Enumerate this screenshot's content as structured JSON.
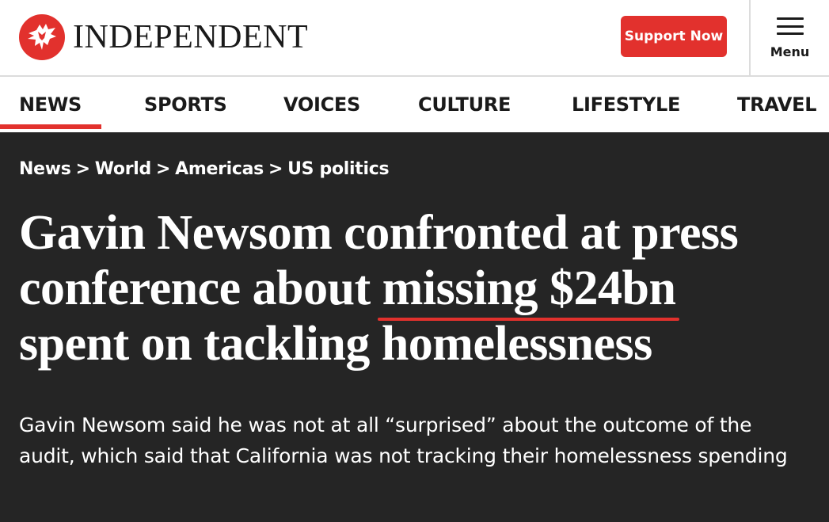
{
  "brand": {
    "name": "INDEPENDENT",
    "logo_icon": "eagle-icon",
    "accent_color": "#e2312d"
  },
  "header": {
    "support_label": "Support Now",
    "menu_label": "Menu",
    "menu_icon": "hamburger-icon"
  },
  "nav": {
    "items": [
      {
        "label": "NEWS",
        "active": true
      },
      {
        "label": "SPORTS"
      },
      {
        "label": "VOICES"
      },
      {
        "label": "CULTURE"
      },
      {
        "label": "LIFESTYLE"
      },
      {
        "label": "TRAVEL"
      }
    ]
  },
  "article": {
    "breadcrumb": [
      "News",
      "World",
      "Americas",
      "US politics"
    ],
    "breadcrumb_separator": ">",
    "headline": {
      "line1": "Gavin Newsom confronted at press",
      "line2_before": "conference about ",
      "line2_highlight": "missing $24bn",
      "line3": "spent on tackling homelessness"
    },
    "standfirst": "Gavin Newsom said he was not at all “surprised” about the outcome of the audit, which said that California was not tracking their homelessness spending",
    "background_color": "#252525"
  }
}
